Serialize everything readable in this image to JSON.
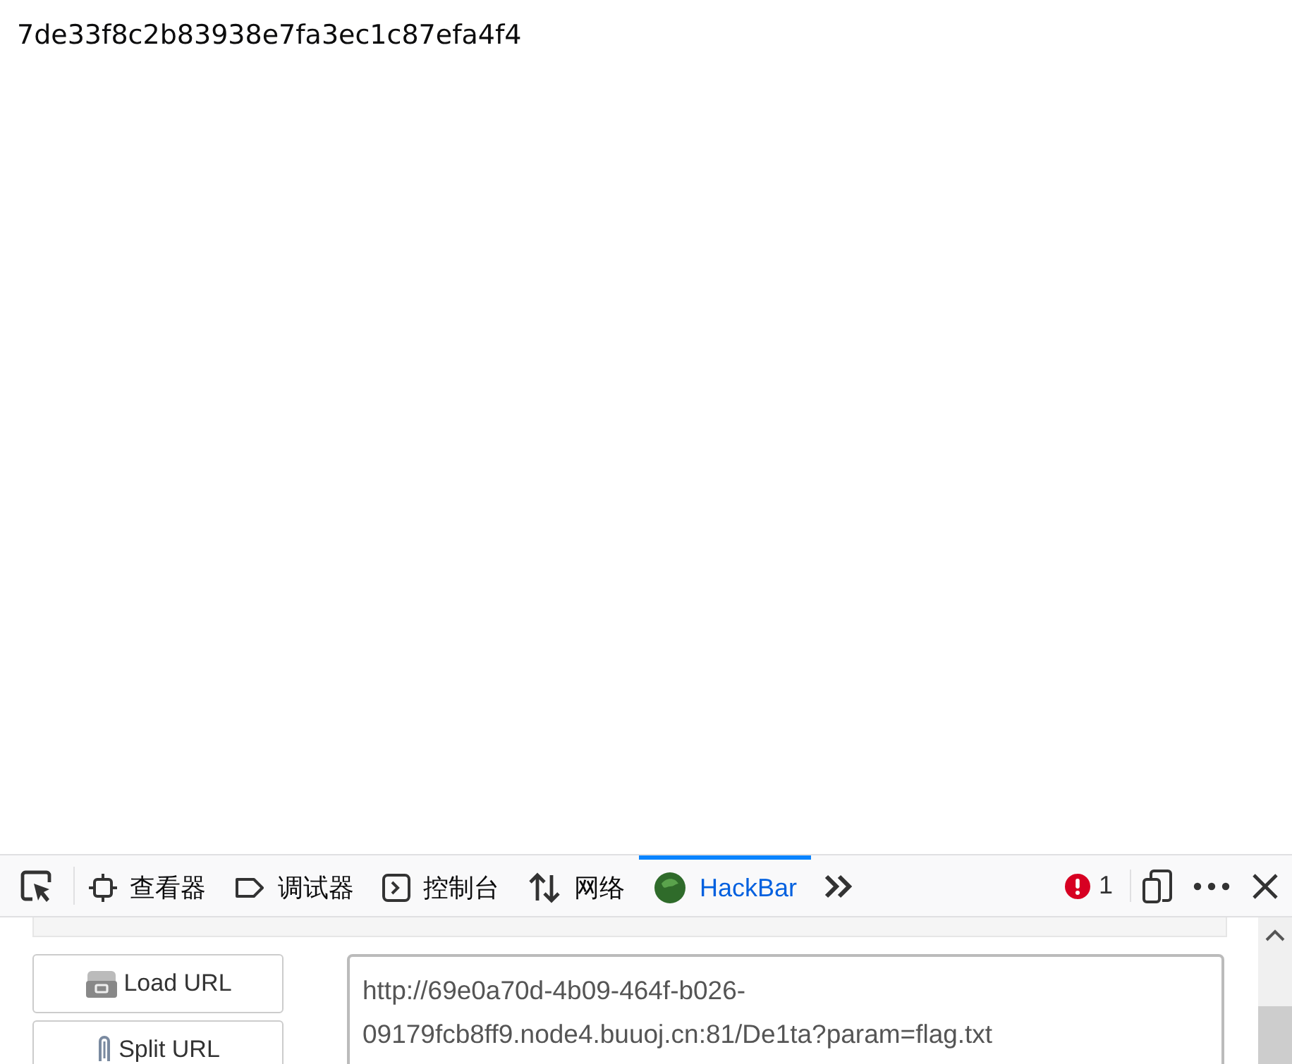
{
  "page": {
    "text": "7de33f8c2b83938e7fa3ec1c87efa4f4"
  },
  "devtools": {
    "tabs": [
      {
        "kind": "inspector",
        "label": "查看器",
        "selected": false
      },
      {
        "kind": "debugger",
        "label": "调试器",
        "selected": false
      },
      {
        "kind": "console",
        "label": "控制台",
        "selected": false
      },
      {
        "kind": "network",
        "label": "网络",
        "selected": false
      },
      {
        "kind": "hackbar",
        "label": "HackBar",
        "selected": true
      }
    ],
    "error_count": "1"
  },
  "hackbar": {
    "buttons": [
      {
        "kind": "load",
        "label": "Load URL"
      },
      {
        "kind": "split",
        "label": "Split URL"
      }
    ],
    "url": "http://69e0a70d-4b09-464f-b026-09179fcb8ff9.node4.buuoj.cn:81/De1ta?param=flag.txt"
  }
}
